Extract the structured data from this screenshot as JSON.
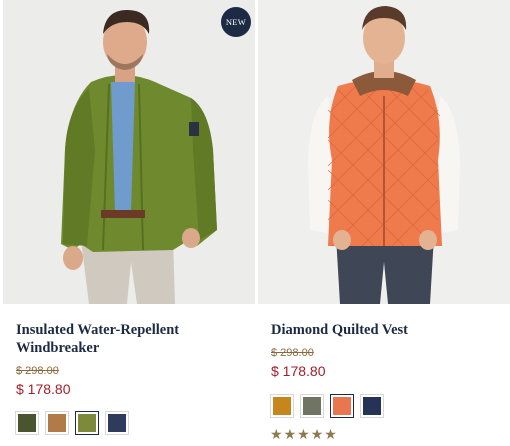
{
  "products": [
    {
      "badge": "NEW",
      "title": "Insulated Water-Repellent Windbreaker",
      "original_price": "$ 298.00",
      "sale_price": "$ 178.80",
      "swatches": [
        {
          "name": "olive-dark",
          "color": "#4a5530",
          "selected": false
        },
        {
          "name": "tan",
          "color": "#b07b48",
          "selected": false
        },
        {
          "name": "green",
          "color": "#7d8a3c",
          "selected": true
        },
        {
          "name": "navy",
          "color": "#2f3b5c",
          "selected": false
        }
      ]
    },
    {
      "title": "Diamond Quilted Vest",
      "original_price": "$ 298.00",
      "sale_price": "$ 178.80",
      "swatches": [
        {
          "name": "mustard",
          "color": "#c7861c",
          "selected": false
        },
        {
          "name": "olive-grey",
          "color": "#6f7463",
          "selected": false
        },
        {
          "name": "orange",
          "color": "#e8764e",
          "selected": true
        },
        {
          "name": "navy",
          "color": "#253456",
          "selected": false
        }
      ],
      "rating": {
        "value": 5,
        "max": 5,
        "glyph": "★"
      }
    }
  ]
}
